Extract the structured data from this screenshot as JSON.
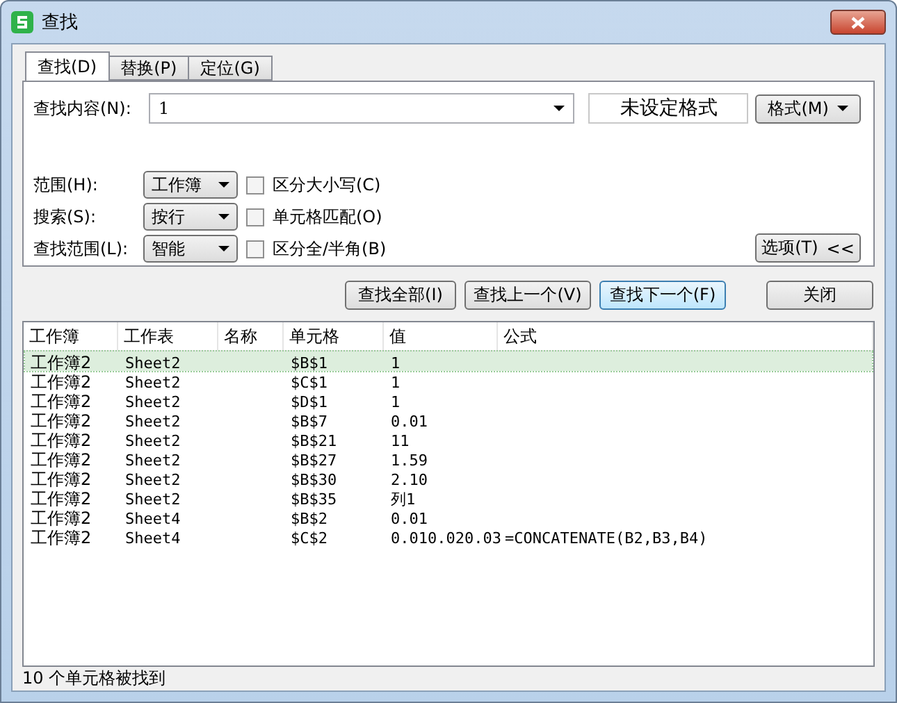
{
  "window": {
    "title": "查找"
  },
  "tabs": [
    {
      "label": "查找(D)",
      "selected": true
    },
    {
      "label": "替换(P)",
      "selected": false
    },
    {
      "label": "定位(G)",
      "selected": false
    }
  ],
  "find": {
    "label": "查找内容(N):",
    "value": "1",
    "format_display": "未设定格式",
    "format_button": "格式(M)"
  },
  "options": [
    {
      "label": "范围(H):",
      "select": "工作簿",
      "checkbox": "区分大小写(C)",
      "checked": false
    },
    {
      "label": "搜索(S):",
      "select": "按行",
      "checkbox": "单元格匹配(O)",
      "checked": false
    },
    {
      "label": "查找范围(L):",
      "select": "智能",
      "checkbox": "区分全/半角(B)",
      "checked": false
    }
  ],
  "options_button": {
    "label": "选项(T)",
    "arrows": "<<"
  },
  "buttons": [
    {
      "label": "查找全部(I)",
      "focused": false
    },
    {
      "label": "查找上一个(V)",
      "focused": false
    },
    {
      "label": "查找下一个(F)",
      "focused": true
    }
  ],
  "close_button": "关闭",
  "table": {
    "columns": [
      "工作簿",
      "工作表",
      "名称",
      "单元格",
      "值",
      "公式"
    ],
    "rows": [
      {
        "cells": [
          "工作簿2",
          "Sheet2",
          "",
          "$B$1",
          "1",
          ""
        ],
        "selected": true
      },
      {
        "cells": [
          "工作簿2",
          "Sheet2",
          "",
          "$C$1",
          "1",
          ""
        ],
        "selected": false
      },
      {
        "cells": [
          "工作簿2",
          "Sheet2",
          "",
          "$D$1",
          "1",
          ""
        ],
        "selected": false
      },
      {
        "cells": [
          "工作簿2",
          "Sheet2",
          "",
          "$B$7",
          "0.01",
          ""
        ],
        "selected": false
      },
      {
        "cells": [
          "工作簿2",
          "Sheet2",
          "",
          "$B$21",
          "11",
          ""
        ],
        "selected": false
      },
      {
        "cells": [
          "工作簿2",
          "Sheet2",
          "",
          "$B$27",
          "1.59",
          ""
        ],
        "selected": false
      },
      {
        "cells": [
          "工作簿2",
          "Sheet2",
          "",
          "$B$30",
          "2.10",
          ""
        ],
        "selected": false
      },
      {
        "cells": [
          "工作簿2",
          "Sheet2",
          "",
          "$B$35",
          "列1",
          ""
        ],
        "selected": false
      },
      {
        "cells": [
          "工作簿2",
          "Sheet4",
          "",
          "$B$2",
          "0.01",
          ""
        ],
        "selected": false
      },
      {
        "cells": [
          "工作簿2",
          "Sheet4",
          "",
          "$C$2",
          "0.010.020.03",
          "=CONCATENATE(B2,B3,B4)"
        ],
        "selected": false
      }
    ]
  },
  "status_bar": "10 个单元格被找到"
}
